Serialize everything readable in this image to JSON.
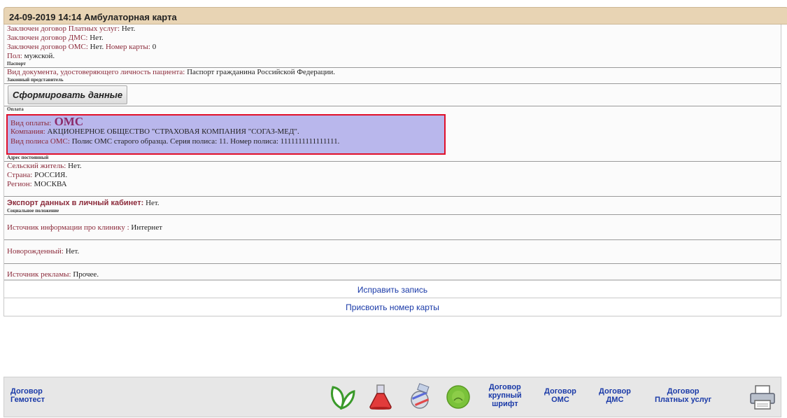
{
  "header": {
    "title": "24-09-2019 14:14 Амбулаторная карта"
  },
  "card": {
    "rows": [
      {
        "label": "Заключен договор Платных услуг:",
        "value": " Нет."
      },
      {
        "label": "Заключен договор ДМС:",
        "value": " Нет."
      },
      {
        "label": "Заключен договор ОМС:",
        "value": " Нет.",
        "label2": " Номер карты:",
        "value2": " 0"
      },
      {
        "label": "Пол:",
        "value": " мужской."
      }
    ],
    "section_passport": "Паспорт",
    "doc_label": "Вид документа, удостоверяющего личность пациента:",
    "doc_value": " Паспорт гражданина Российской Федерации.",
    "section_representative": "Законный представитель",
    "form_button": "Сформировать данные",
    "section_payment": "Оплата",
    "payment": {
      "type_label": "Вид оплаты:",
      "type_value": " ОМС",
      "company_label": "Компания:",
      "company_value": " АКЦИОНЕРНОЕ ОБЩЕСТВО \"СТРАХОВАЯ КОМПАНИЯ \"СОГАЗ-МЕД\".",
      "policy_label": "Вид полиса ОМС:",
      "policy_value": " Полис ОМС старого образца. Серия полиса: 11. Номер полиса: 1111111111111111."
    },
    "section_address": "Адрес постоянный",
    "address": [
      {
        "label": "Сельский житель:",
        "value": " Нет."
      },
      {
        "label": "Страна:",
        "value": " РОССИЯ."
      },
      {
        "label": "Регион:",
        "value": " МОСКВА"
      }
    ],
    "export_label": "Экспорт данных в личный кабинет:",
    "export_value": " Нет.",
    "section_social": "Социальное положение",
    "source_label": "Источник информации про клинику :",
    "source_value": " Интернет",
    "newborn_label": "Новорожденный:",
    "newborn_value": " Нет.",
    "ad_label": "Источник рекламы:",
    "ad_value": " Прочее."
  },
  "actions": {
    "edit": "Исправить запись",
    "assign_number": "Присвоить номер карты"
  },
  "toolbar": {
    "gemotest": [
      "Договор",
      "Гемотест"
    ],
    "large_font": [
      "Договор",
      "крупный",
      "шрифт"
    ],
    "oms": [
      "Договор",
      "ОМС"
    ],
    "dms": [
      "Договор",
      "ДМС"
    ],
    "paid": [
      "Договор",
      "Платных услуг"
    ],
    "icons": [
      "leaf-icon",
      "flask-icon",
      "satellite-icon",
      "status-circle-icon",
      "printer-icon"
    ]
  }
}
